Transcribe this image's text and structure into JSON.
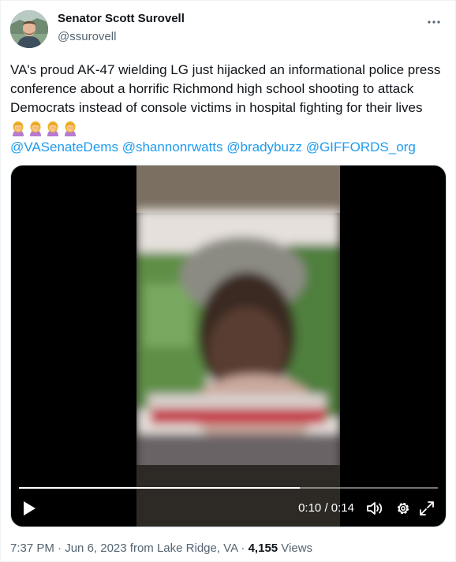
{
  "author": {
    "name": "Senator Scott Surovell",
    "handle": "@ssurovell"
  },
  "tweet": {
    "text": "VA's proud AK-47 wielding LG just hijacked an informational police press conference about a horrific Richmond high school shooting to attack Democrats instead of console victims in hospital fighting for their lives",
    "emoji_icon": "woman-facepalming-emoji",
    "emoji_count": 4,
    "mentions": [
      "@VASenateDems",
      "@shannonrwatts",
      "@bradybuzz",
      "@GIFFORDS_org"
    ]
  },
  "video": {
    "current_time": "0:10",
    "separator": " / ",
    "duration": "0:14",
    "progress_fraction": 0.67,
    "controls": [
      "play-icon",
      "volume-icon",
      "settings-gear-icon",
      "fullscreen-icon"
    ]
  },
  "meta": {
    "time": "7:37 PM",
    "dot1": " · ",
    "date": "Jun 6, 2023",
    "location": " from Lake Ridge, VA",
    "dot2": " · ",
    "views_count": "4,155",
    "views_label": " Views"
  },
  "colors": {
    "link": "#1d9bf0",
    "text": "#0f1419",
    "secondary": "#536471"
  }
}
